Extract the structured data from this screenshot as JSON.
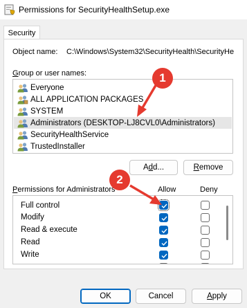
{
  "window": {
    "title": "Permissions for SecurityHealthSetup.exe"
  },
  "tabs": [
    {
      "label": "Security"
    }
  ],
  "object": {
    "label": "Object name:",
    "value": "C:\\Windows\\System32\\SecurityHealth\\SecurityHe"
  },
  "groups": {
    "label_pre": "",
    "label_accel": "G",
    "label_post": "roup or user names:",
    "items": [
      {
        "label": "Everyone",
        "icon": "users-icon"
      },
      {
        "label": "ALL APPLICATION PACKAGES",
        "icon": "package-users-icon"
      },
      {
        "label": "SYSTEM",
        "icon": "users-icon"
      },
      {
        "label": "Administrators (DESKTOP-LJ8CVL0\\Administrators)",
        "icon": "users-icon",
        "selected": true
      },
      {
        "label": "SecurityHealthService",
        "icon": "users-icon"
      },
      {
        "label": "TrustedInstaller",
        "icon": "users-icon"
      }
    ]
  },
  "buttons": {
    "add_pre": "A",
    "add_accel": "d",
    "add_post": "d...",
    "remove_accel": "R",
    "remove_post": "emove",
    "ok": "OK",
    "cancel": "Cancel",
    "apply_accel": "A",
    "apply_post": "pply"
  },
  "permissions": {
    "label_pre": "",
    "label_accel": "P",
    "label_post": "ermissions for Administrators",
    "allow_header": "Allow",
    "deny_header": "Deny",
    "rows": [
      {
        "label": "Full control",
        "allow": true,
        "deny": false
      },
      {
        "label": "Modify",
        "allow": true,
        "deny": false
      },
      {
        "label": "Read & execute",
        "allow": true,
        "deny": false
      },
      {
        "label": "Read",
        "allow": true,
        "deny": false
      },
      {
        "label": "Write",
        "allow": true,
        "deny": false
      }
    ]
  },
  "annotations": [
    {
      "number": "1"
    },
    {
      "number": "2"
    }
  ],
  "colors": {
    "accent": "#0067c0",
    "annotation": "#e53a2f"
  }
}
